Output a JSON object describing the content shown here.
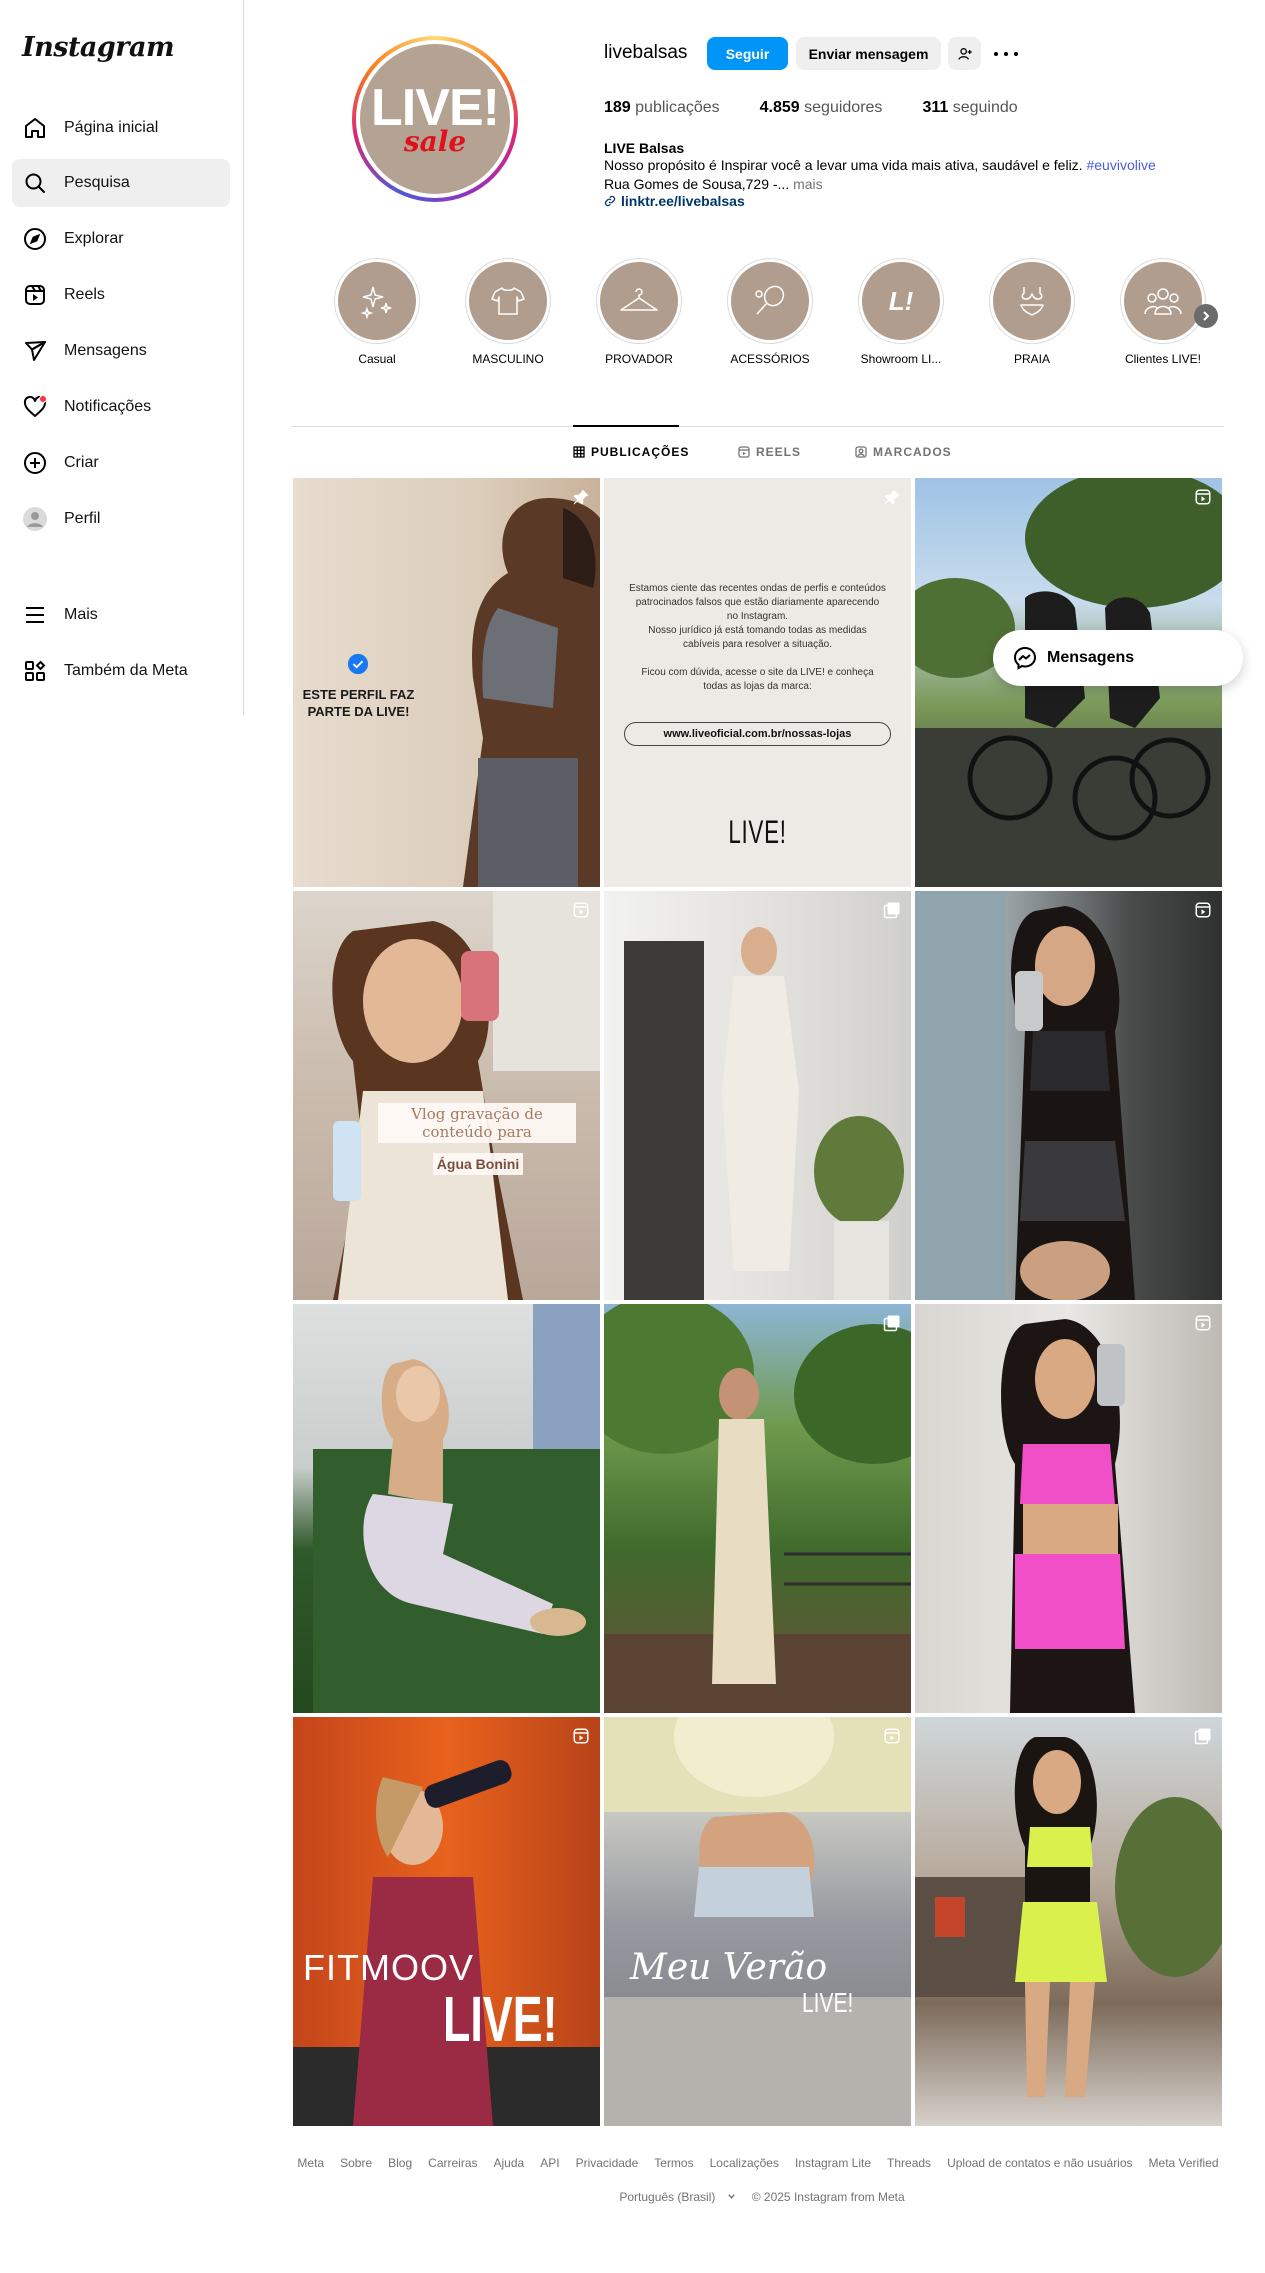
{
  "sidebar": {
    "logo": "Instagram",
    "items": [
      {
        "label": "Página inicial",
        "icon": "home-icon"
      },
      {
        "label": "Pesquisa",
        "icon": "search-icon"
      },
      {
        "label": "Explorar",
        "icon": "compass-icon"
      },
      {
        "label": "Reels",
        "icon": "reels-icon"
      },
      {
        "label": "Mensagens",
        "icon": "direct-icon"
      },
      {
        "label": "Notificações",
        "icon": "heart-icon"
      },
      {
        "label": "Criar",
        "icon": "plus-square-icon"
      },
      {
        "label": "Perfil",
        "icon": "profile-avatar-icon"
      },
      {
        "label": "Mais",
        "icon": "menu-icon"
      },
      {
        "label": "Também da Meta",
        "icon": "meta-apps-icon"
      }
    ],
    "active_item": "Pesquisa"
  },
  "profile": {
    "avatar_text_top": "LIVE!",
    "avatar_text_bottom": "sale",
    "username": "livebalsas",
    "follow_label": "Seguir",
    "message_label": "Enviar mensagem",
    "stats": {
      "posts_count": "189",
      "posts_label": "publicações",
      "followers_count": "4.859",
      "followers_label": "seguidores",
      "following_count": "311",
      "following_label": "seguindo"
    },
    "bio": {
      "name": "LIVE Balsas",
      "text": "Nosso propósito é Inspirar você a levar uma vida mais ativa, saudável e feliz.",
      "hashtag": "#euvivolive",
      "address": "Rua Gomes de Sousa,729 -...",
      "more": "mais",
      "link": "linktr.ee/livebalsas"
    }
  },
  "highlights": [
    {
      "label": "Casual",
      "icon": "sparkles-icon"
    },
    {
      "label": "MASCULINO",
      "icon": "tshirt-icon"
    },
    {
      "label": "PROVADOR",
      "icon": "hanger-icon"
    },
    {
      "label": "ACESSÓRIOS",
      "icon": "racket-icon"
    },
    {
      "label": "Showroom LI...",
      "icon": "live-logo-icon"
    },
    {
      "label": "PRAIA",
      "icon": "bikini-icon"
    },
    {
      "label": "Clientes LIVE!",
      "icon": "people-icon"
    }
  ],
  "tabs": [
    {
      "label": "PUBLICAÇÕES",
      "icon": "grid-icon"
    },
    {
      "label": "REELS",
      "icon": "reels-icon"
    },
    {
      "label": "MARCADOS",
      "icon": "tagged-icon"
    }
  ],
  "posts": {
    "p1_caption": "ESTE PERFIL FAZ PARTE DA LIVE!",
    "p2_lines": [
      "Estamos ciente das recentes ondas de perfis e conteúdos",
      "patrocinados falsos que estão diariamente aparecendo",
      "no Instagram.",
      "Nosso jurídico já está tomando todas as medidas",
      "cabíveis para resolver a situação.",
      "",
      "Ficou com dúvida, acesse o site da LIVE! e conheça",
      "todas as lojas da marca:"
    ],
    "p2_url": "www.liveoficial.com.br/nossas-lojas",
    "p2_logo": "LIVE!",
    "p4_caption_1": "Vlog gravação de conteúdo para",
    "p4_caption_2": "Água Bonini",
    "p10_brand": "FITMOOV",
    "p10_logo": "LIVE!",
    "p11_title": "Meu Verão",
    "p11_logo": "LIVE!"
  },
  "floating_messages": {
    "label": "Mensagens",
    "icon": "messenger-icon"
  },
  "footer": {
    "links": [
      "Meta",
      "Sobre",
      "Blog",
      "Carreiras",
      "Ajuda",
      "API",
      "Privacidade",
      "Termos",
      "Localizações",
      "Instagram Lite",
      "Threads",
      "Upload de contatos e não usuários",
      "Meta Verified"
    ],
    "language": "Português (Brasil)",
    "copyright": "© 2025 Instagram from Meta"
  },
  "colors": {
    "accent": "#0095f6",
    "highlight_bg": "#b09d8d",
    "notification_dot": "#ff3040",
    "hashtag": "#4a5dd8"
  }
}
